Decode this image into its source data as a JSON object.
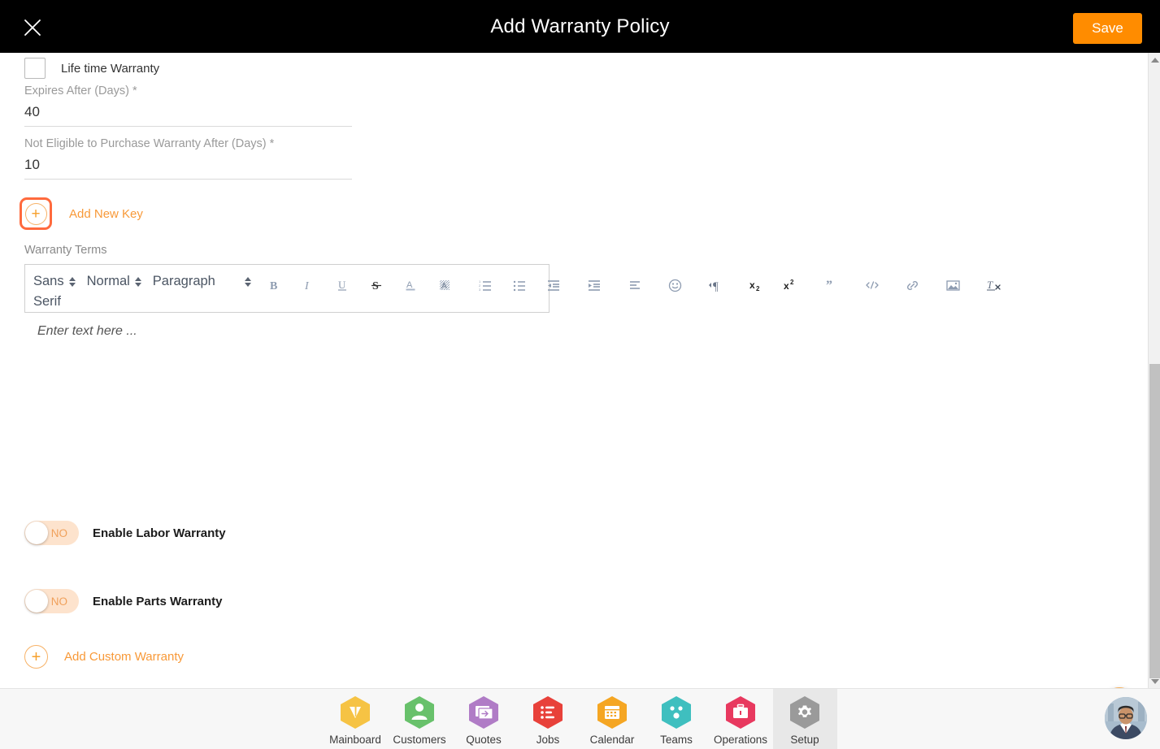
{
  "header": {
    "title": "Add Warranty Policy",
    "close_icon": "close-icon",
    "save_label": "Save"
  },
  "form": {
    "lifetime_warranty": {
      "label": "Life time Warranty",
      "checked": false
    },
    "expires_after": {
      "label": "Expires After (Days) *",
      "value": "40"
    },
    "not_eligible_after": {
      "label": "Not Eligible to Purchase Warranty After (Days) *",
      "value": "10"
    },
    "add_new_key": {
      "label": "Add New Key",
      "icon": "plus-circle-icon",
      "focused": true
    },
    "warranty_terms": {
      "caption": "Warranty Terms",
      "placeholder": "Enter text here ...",
      "toolbar": {
        "font_family": "Sans Serif",
        "font_size": "Normal",
        "block_format": "Paragraph",
        "buttons": [
          "bold-icon",
          "italic-icon",
          "underline-icon",
          "strikethrough-icon",
          "text-color-icon",
          "background-color-icon",
          "ordered-list-icon",
          "bullet-list-icon",
          "outdent-icon",
          "indent-icon",
          "align-icon",
          "emoji-icon",
          "text-direction-icon",
          "subscript-icon",
          "superscript-icon",
          "blockquote-icon",
          "code-block-icon",
          "link-icon",
          "image-icon",
          "clear-formatting-icon"
        ]
      }
    },
    "enable_labor_warranty": {
      "label": "Enable Labor Warranty",
      "state": "NO"
    },
    "enable_parts_warranty": {
      "label": "Enable Parts Warranty",
      "state": "NO"
    },
    "add_custom_warranty": {
      "label": "Add Custom Warranty",
      "icon": "plus-circle-icon"
    }
  },
  "scroll_top_button": {
    "icon": "chevron-up-icon"
  },
  "scrollbar": {
    "up_arrow": "caret-up-icon",
    "down_arrow": "caret-down-icon"
  },
  "bottom_nav": {
    "items": [
      {
        "label": "Mainboard",
        "icon": "mainboard-icon",
        "color": "#f6c344",
        "active": false
      },
      {
        "label": "Customers",
        "icon": "user-icon",
        "color": "#68c16b",
        "active": false
      },
      {
        "label": "Quotes",
        "icon": "quotes-icon",
        "color": "#b07cc6",
        "active": false
      },
      {
        "label": "Jobs",
        "icon": "jobs-list-icon",
        "color": "#e8413a",
        "active": false
      },
      {
        "label": "Calendar",
        "icon": "calendar-icon",
        "color": "#f5a623",
        "active": false
      },
      {
        "label": "Teams",
        "icon": "teams-icon",
        "color": "#3fbfbf",
        "active": false
      },
      {
        "label": "Operations",
        "icon": "briefcase-icon",
        "color": "#e8395f",
        "active": false
      },
      {
        "label": "Setup",
        "icon": "gear-icon",
        "color": "#9a9a9a",
        "active": true
      }
    ]
  },
  "user_avatar": {
    "icon": "avatar"
  },
  "colors": {
    "accent_orange": "#ff8c00",
    "link_orange": "#f89938",
    "focus_ring": "#ff6a3d",
    "header_bg": "#000000",
    "toggle_track": "#fde3cd"
  }
}
